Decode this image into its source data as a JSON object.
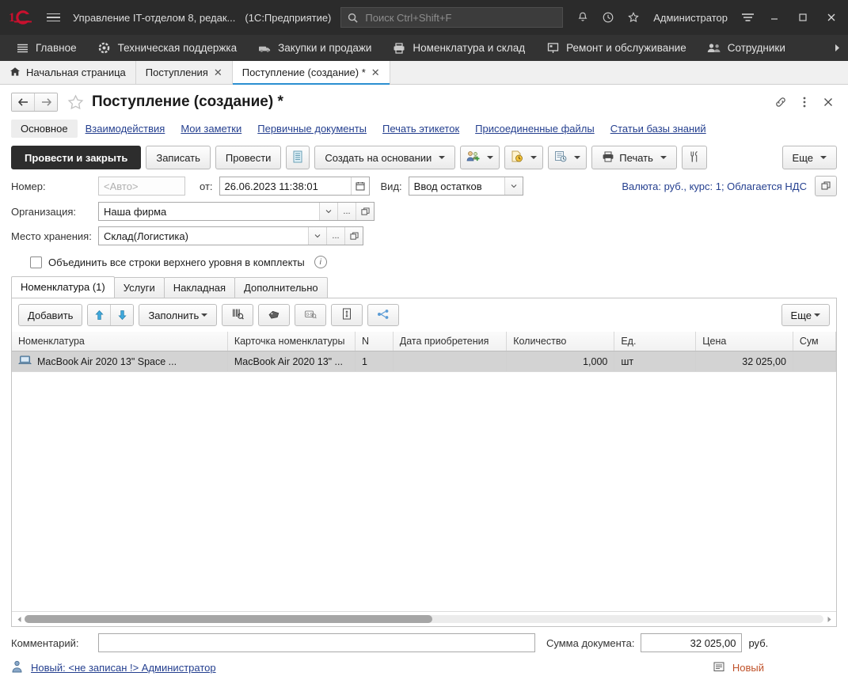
{
  "titlebar": {
    "logo_alt": "1c-logo",
    "app_title": "Управление IT-отделом 8, редак...",
    "app_mode": "(1С:Предприятие)",
    "search_placeholder": "Поиск Ctrl+Shift+F",
    "search_value": "",
    "user": "Администратор",
    "icons": [
      "bell-icon",
      "history-icon",
      "star-icon",
      "menu-lines-icon"
    ],
    "window_buttons": [
      "minimize",
      "maximize",
      "close"
    ]
  },
  "sections": {
    "items": [
      {
        "label": "Главное",
        "icon": "lines-icon"
      },
      {
        "label": "Техническая поддержка",
        "icon": "support-icon"
      },
      {
        "label": "Закупки и продажи",
        "icon": "truck-icon"
      },
      {
        "label": "Номенклатура и склад",
        "icon": "printer-icon"
      },
      {
        "label": "Ремонт и обслуживание",
        "icon": "repair-icon"
      },
      {
        "label": "Сотрудники",
        "icon": "people-icon"
      }
    ],
    "more": "▶"
  },
  "window_tabs": [
    {
      "label": "Начальная страница",
      "icon": "home-icon",
      "closable": false,
      "active": false
    },
    {
      "label": "Поступления",
      "closable": true,
      "active": false
    },
    {
      "label": "Поступление (создание) *",
      "closable": true,
      "active": true
    }
  ],
  "document": {
    "title": "Поступление (создание) *",
    "back_arrow": "←",
    "forward_arrow": "→",
    "favorite_icon": "star-outline-icon",
    "head_icons": [
      "link-icon",
      "kebab-menu-icon",
      "close-icon"
    ],
    "nav_links": [
      {
        "label": "Основное",
        "current": true
      },
      {
        "label": "Взаимодействия",
        "current": false
      },
      {
        "label": "Мои заметки",
        "current": false
      },
      {
        "label": "Первичные документы",
        "current": false
      },
      {
        "label": "Печать этикеток",
        "current": false
      },
      {
        "label": "Присоединенные файлы",
        "current": false
      },
      {
        "label": "Статьи базы знаний",
        "current": false
      }
    ]
  },
  "commandbar": {
    "post_and_close": "Провести и закрыть",
    "write": "Записать",
    "post": "Провести",
    "register_icon": "movements-icon",
    "create_based_on": "Создать на основании",
    "contact_icon": "add-contact-icon",
    "reminder_icon": "reminder-icon",
    "report_icon": "report-icon",
    "print": "Печать",
    "print_icon": "printer-icon",
    "tools_icon": "tools-icon",
    "more": "Еще"
  },
  "fields": {
    "number_label": "Номер:",
    "number_placeholder": "<Авто>",
    "number_value": "",
    "date_label": "от:",
    "date_value": "26.06.2023 11:38:01",
    "date_icon": "calendar-icon",
    "kind_label": "Вид:",
    "kind_value": "Ввод остатков",
    "currency_info": "Валюта: руб., курс: 1; Облагается НДС",
    "currency_open_icon": "open-window-icon",
    "org_label": "Организация:",
    "org_value": "Наша фирма",
    "storage_label": "Место хранения:",
    "storage_value": "Склад(Логистика)",
    "checkbox_label": "Объединить все строки верхнего уровня в комплекты",
    "checkbox_checked": false,
    "info_icon": "info-icon"
  },
  "inner_tabs": [
    {
      "label": "Номенклатура (1)",
      "active": true
    },
    {
      "label": "Услуги",
      "active": false
    },
    {
      "label": "Накладная",
      "active": false
    },
    {
      "label": "Дополнительно",
      "active": false
    }
  ],
  "table_toolbar": {
    "add": "Добавить",
    "move_up_icon": "arrow-up-icon",
    "move_down_icon": "arrow-down-icon",
    "fill": "Заполнить",
    "barcode_icon": "barcode-scan-icon",
    "label_icon": "price-tag-icon",
    "serial_icon": "serial-number-icon",
    "resize_icon": "row-height-icon",
    "structure_icon": "hierarchy-icon",
    "more": "Еще"
  },
  "table": {
    "columns": [
      "Номенклатура",
      "Карточка номенклатуры",
      "N",
      "Дата приобретения",
      "Количество",
      "Ед.",
      "Цена",
      "Сум"
    ],
    "rows": [
      {
        "selected": true,
        "icon": "laptop-icon",
        "nomenclature": "MacBook Air 2020 13\" Space ...",
        "card": "MacBook Air 2020 13\" ...",
        "n": "1",
        "purchase_date": "",
        "quantity": "1,000",
        "unit": "шт",
        "price": "32 025,00",
        "sum": ""
      }
    ]
  },
  "scrollbar": {
    "left_arrow": "◀",
    "right_arrow": "▶",
    "thumb_percent": 51
  },
  "footer": {
    "comment_label": "Комментарий:",
    "comment_value": "",
    "comment_placeholder": "",
    "sum_label": "Сумма документа:",
    "sum_value": "32 025,00",
    "currency": "руб.",
    "status_user_icon": "user-icon",
    "status_link": "Новый: <не записан !> Администратор",
    "status_note_icon": "note-icon",
    "status_text": "Новый"
  },
  "colors": {
    "titlebar_bg": "#2b2b2b",
    "sections_bg": "#333333",
    "accent_tab": "#2b8fd1",
    "link": "#243f8f",
    "status_new": "#c0522a",
    "primary_button": "#2d2d2d",
    "row_selected": "#d3d3d3",
    "logo_red": "#c8102e"
  }
}
